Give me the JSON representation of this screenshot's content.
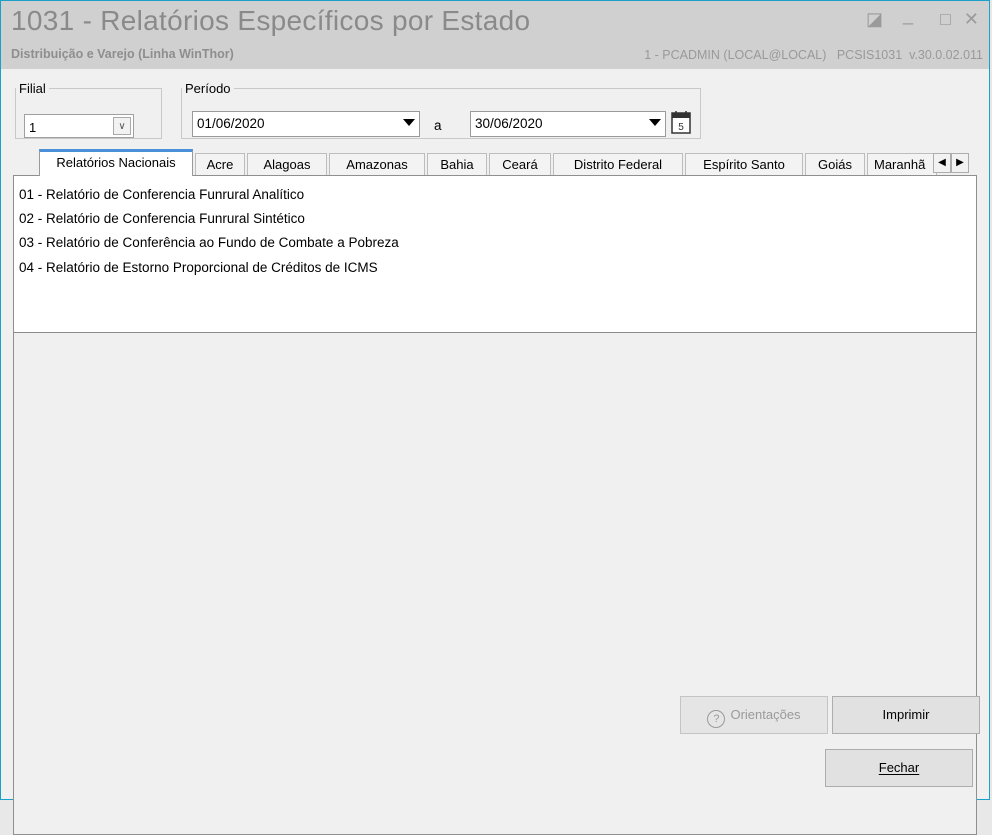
{
  "window": {
    "title": "1031 - Relatórios Específicos por Estado",
    "subtitle": "Distribuição e Varejo (Linha WinThor)",
    "right_info": "1 - PCADMIN (LOCAL@LOCAL)   PCSIS1031  v.30.0.02.011",
    "controls": {
      "restore": "◪",
      "minimize": "_",
      "maximize": "□",
      "close": "✕"
    }
  },
  "filters": {
    "filial_label": "Filial",
    "filial_value": "1",
    "periodo_label": "Período",
    "date_from": "01/06/2020",
    "date_separator": "a",
    "date_to": "30/06/2020"
  },
  "tabs": [
    {
      "label": "Relatórios Nacionais"
    },
    {
      "label": "Acre"
    },
    {
      "label": "Alagoas"
    },
    {
      "label": "Amazonas"
    },
    {
      "label": "Bahia"
    },
    {
      "label": "Ceará"
    },
    {
      "label": "Distrito Federal"
    },
    {
      "label": "Espírito Santo"
    },
    {
      "label": "Goiás"
    },
    {
      "label": "Maranhã"
    }
  ],
  "reports": [
    "01 - Relatório de Conferencia Funrural Analítico",
    "02 - Relatório de Conferencia Funrural Sintético",
    "03 - Relatório de Conferência ao Fundo de Combate a Pobreza",
    "04 - Relatório de Estorno Proporcional de Créditos de ICMS"
  ],
  "buttons": {
    "orientacoes": "Orientações",
    "imprimir": "Imprimir",
    "fechar": "Fechar"
  }
}
